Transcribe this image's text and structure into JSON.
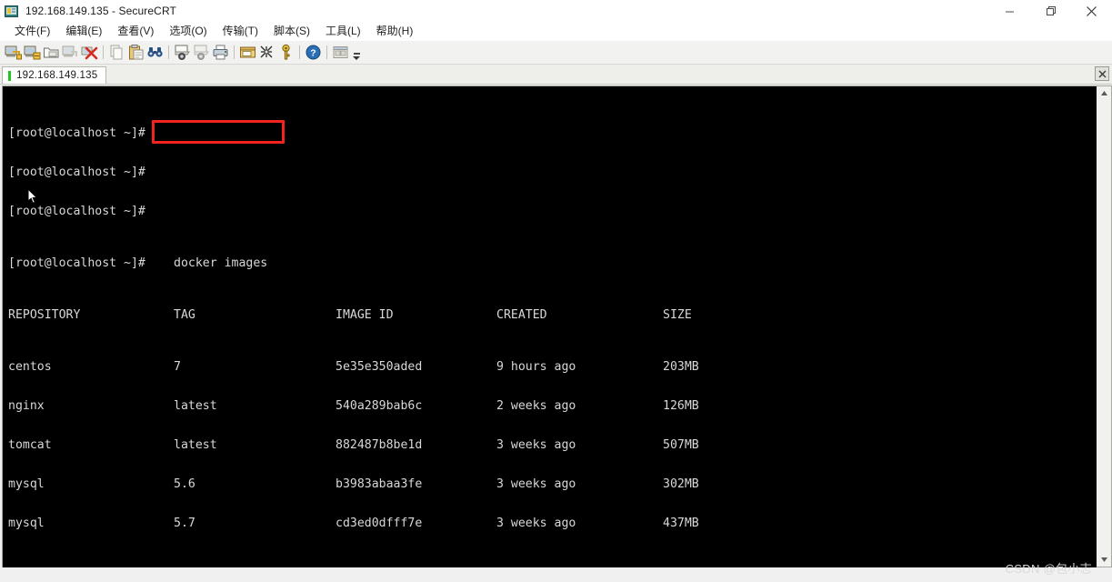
{
  "window": {
    "title": "192.168.149.135 - SecureCRT",
    "app_icon": "securecrt-icon",
    "minimize_label": "—",
    "maximize_label": "❐",
    "close_label": "✕"
  },
  "menu": {
    "items": [
      {
        "label": "文件(F)",
        "name": "menu-file"
      },
      {
        "label": "编辑(E)",
        "name": "menu-edit"
      },
      {
        "label": "查看(V)",
        "name": "menu-view"
      },
      {
        "label": "选项(O)",
        "name": "menu-options"
      },
      {
        "label": "传输(T)",
        "name": "menu-transfer"
      },
      {
        "label": "脚本(S)",
        "name": "menu-script"
      },
      {
        "label": "工具(L)",
        "name": "menu-tools"
      },
      {
        "label": "帮助(H)",
        "name": "menu-help"
      }
    ]
  },
  "toolbar": {
    "buttons": [
      {
        "name": "connect-icon",
        "kind": "connect"
      },
      {
        "name": "connect-in-tab-icon",
        "kind": "connect-tab"
      },
      {
        "name": "connect-local-shell-icon",
        "kind": "folder"
      },
      {
        "name": "reconnect-icon",
        "kind": "reconnect"
      },
      {
        "name": "disconnect-icon",
        "kind": "disconnect"
      },
      {
        "name": "separator",
        "kind": "sep"
      },
      {
        "name": "copy-icon",
        "kind": "copy"
      },
      {
        "name": "paste-icon",
        "kind": "paste"
      },
      {
        "name": "find-icon",
        "kind": "find"
      },
      {
        "name": "separator",
        "kind": "sep"
      },
      {
        "name": "log-session-icon",
        "kind": "log"
      },
      {
        "name": "raw-log-icon",
        "kind": "rawlog"
      },
      {
        "name": "print-icon",
        "kind": "print"
      },
      {
        "name": "separator",
        "kind": "sep"
      },
      {
        "name": "session-options-icon",
        "kind": "options"
      },
      {
        "name": "clear-screen-icon",
        "kind": "scissors"
      },
      {
        "name": "key-icon",
        "kind": "key"
      },
      {
        "name": "separator",
        "kind": "sep"
      },
      {
        "name": "help-icon",
        "kind": "help"
      },
      {
        "name": "separator",
        "kind": "sep"
      },
      {
        "name": "arrange-windows-icon",
        "kind": "window"
      }
    ]
  },
  "tabbar": {
    "tabs": [
      {
        "label": "192.168.149.135",
        "active": true,
        "led_color": "#21c421"
      }
    ],
    "close_label": "✕"
  },
  "terminal": {
    "prompt": "[root@localhost ~]#",
    "command": "docker images",
    "prompt_lines_before": 3,
    "columns": [
      "REPOSITORY",
      "TAG",
      "IMAGE ID",
      "CREATED",
      "SIZE"
    ],
    "rows": [
      {
        "repository": "centos",
        "tag": "7",
        "image_id": "5e35e350aded",
        "created": "9 hours ago",
        "size": "203MB"
      },
      {
        "repository": "nginx",
        "tag": "latest",
        "image_id": "540a289bab6c",
        "created": "2 weeks ago",
        "size": "126MB"
      },
      {
        "repository": "tomcat",
        "tag": "latest",
        "image_id": "882487b8be1d",
        "created": "3 weeks ago",
        "size": "507MB"
      },
      {
        "repository": "mysql",
        "tag": "5.6",
        "image_id": "b3983abaa3fe",
        "created": "3 weeks ago",
        "size": "302MB"
      },
      {
        "repository": "mysql",
        "tag": "5.7",
        "image_id": "cd3ed0dfff7e",
        "created": "3 weeks ago",
        "size": "437MB"
      }
    ],
    "background": "#000000",
    "foreground": "#d8d8d8",
    "highlight_color": "#f5231d"
  },
  "scrollbar": {
    "up_arrow": "▲",
    "down_arrow": "▼"
  },
  "watermark": {
    "text": "CSDN @包小志"
  }
}
